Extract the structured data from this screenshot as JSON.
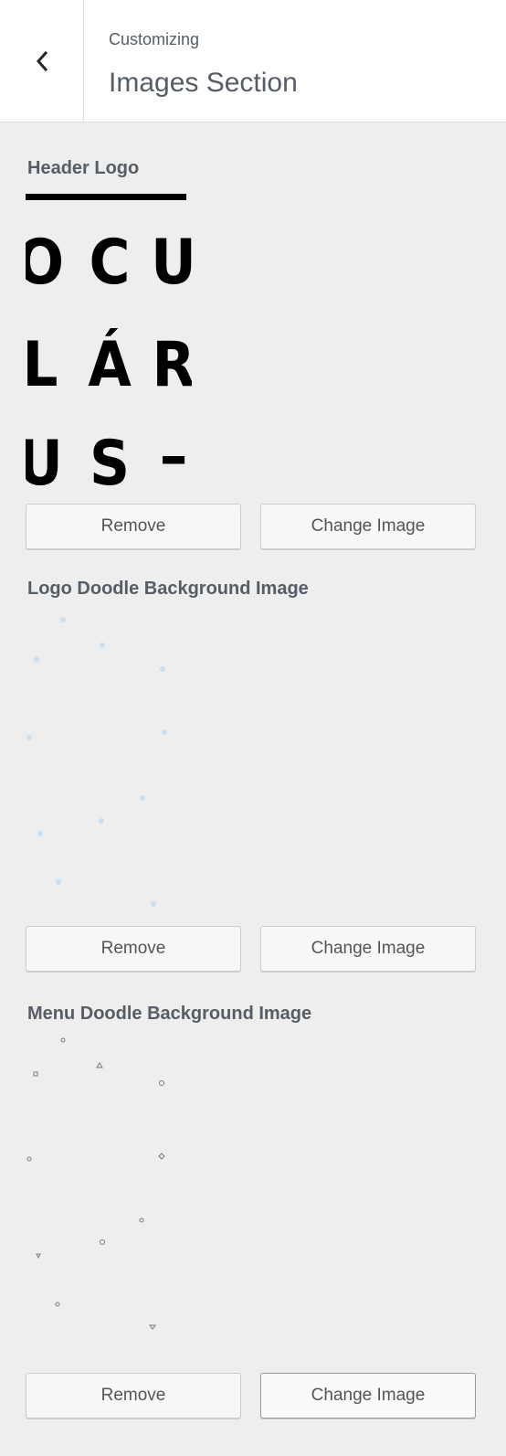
{
  "header": {
    "breadcrumb": "Customizing",
    "title": "Images Section",
    "back_icon": "chevron-left-icon"
  },
  "controls": [
    {
      "label": "Header Logo",
      "logo_text": [
        "O",
        "C",
        "U",
        "L",
        "Á",
        "R",
        "U",
        "S",
        "–"
      ],
      "remove_label": "Remove",
      "change_label": "Change Image"
    },
    {
      "label": "Logo Doodle Background Image",
      "remove_label": "Remove",
      "change_label": "Change Image",
      "doodle_color": "#c9dff2"
    },
    {
      "label": "Menu Doodle Background Image",
      "remove_label": "Remove",
      "change_label": "Change Image",
      "doodle_color": "#7a7a7a"
    }
  ],
  "colors": {
    "panel_bg": "#eeeeee",
    "header_bg": "#ffffff",
    "text": "#555d66"
  }
}
